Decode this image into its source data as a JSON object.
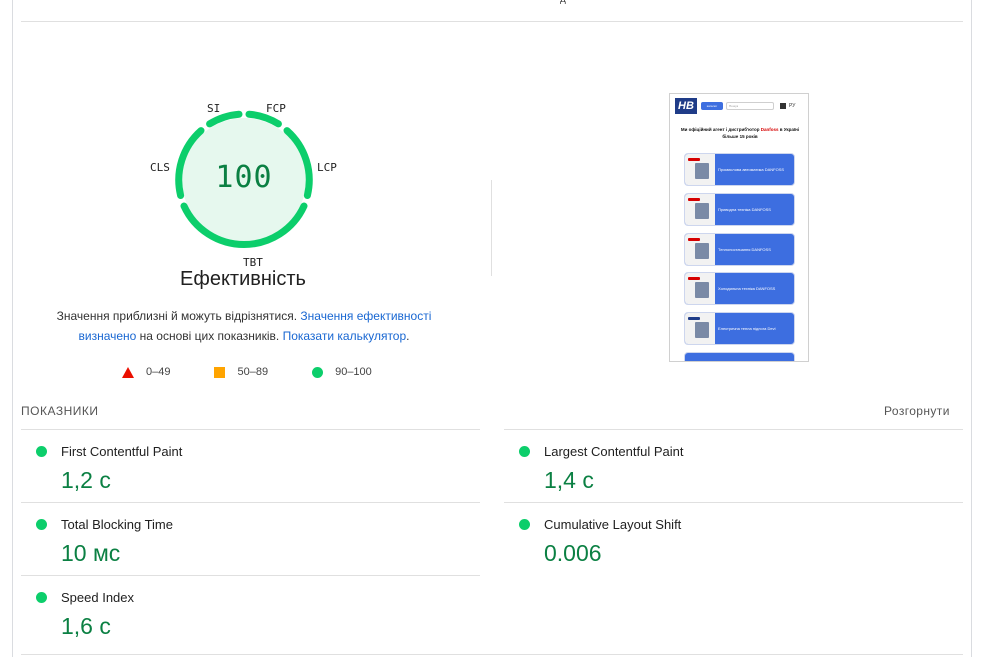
{
  "header": {
    "top_tick": "д"
  },
  "gauge": {
    "score": "100",
    "title": "Ефективність",
    "labels": {
      "si": "SI",
      "fcp": "FCP",
      "lcp": "LCP",
      "tbt": "TBT",
      "cls": "CLS"
    },
    "color": "#0cce6b",
    "fill": "#e6f8ee"
  },
  "description": {
    "part1": "Значення приблизні й можуть відрізнятися. ",
    "link1": "Значення ефективності визначено",
    "part2": " на основі цих показників. ",
    "link2": "Показати калькулятор",
    "part3": "."
  },
  "legend": {
    "poor": "0–49",
    "average": "50–89",
    "good": "90–100"
  },
  "screenshot": {
    "logo": "HB",
    "menu_button": "каталог",
    "search_placeholder": "Пошук",
    "lang": "РУ",
    "heading_part1": "Ми офіційний агент і дистриб'ютор ",
    "heading_brand": "Danfoss",
    "heading_part2": " в Україні більше 15 років",
    "cards": [
      "Промислова автоматика DANFOSS",
      "Приводна техніка DANFOSS",
      "Теплопостачання DANFOSS",
      "Холодильна техніка DANFOSS",
      "Електрична тепла підлога Devi"
    ]
  },
  "metrics_section": {
    "title": "ПОКАЗНИКИ",
    "expand": "Розгорнути",
    "items": [
      {
        "name": "First Contentful Paint",
        "value": "1,2 с"
      },
      {
        "name": "Largest Contentful Paint",
        "value": "1,4 с"
      },
      {
        "name": "Total Blocking Time",
        "value": "10 мс"
      },
      {
        "name": "Cumulative Layout Shift",
        "value": "0.006"
      },
      {
        "name": "Speed Index",
        "value": "1,6 с"
      }
    ]
  },
  "colors": {
    "good": "#0cce6b",
    "good_text": "#0b8043",
    "average": "#ffa400",
    "poor": "#eb0f00",
    "link": "#1967d2"
  }
}
